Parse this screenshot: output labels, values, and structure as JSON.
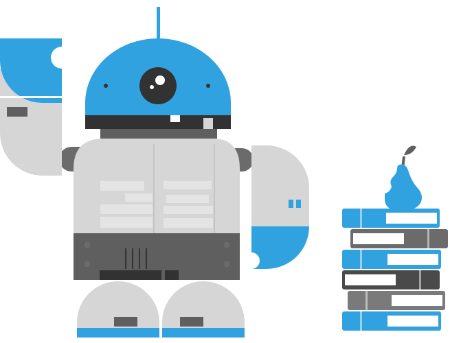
{
  "illustration": {
    "robot": {
      "icon": "robot-icon",
      "body_color": "#d6d6d6",
      "body_highlight": "#e4e4e4",
      "accent_color": "#30a2e0",
      "dark_color": "#323232",
      "mid_dark_color": "#5f5f5f",
      "joint_color": "#6b6b6b"
    },
    "books": {
      "icon": "book-stack-icon",
      "count": 6,
      "cover_colors": [
        "#30a2e0",
        "#6b6b6b",
        "#30a2e0",
        "#4a4a4a",
        "#7a7a7a",
        "#30a2e0"
      ],
      "page_color": "#ffffff"
    },
    "pear": {
      "icon": "pear-icon",
      "color": "#30a2e0",
      "stem_color": "#5f5f5f"
    }
  }
}
